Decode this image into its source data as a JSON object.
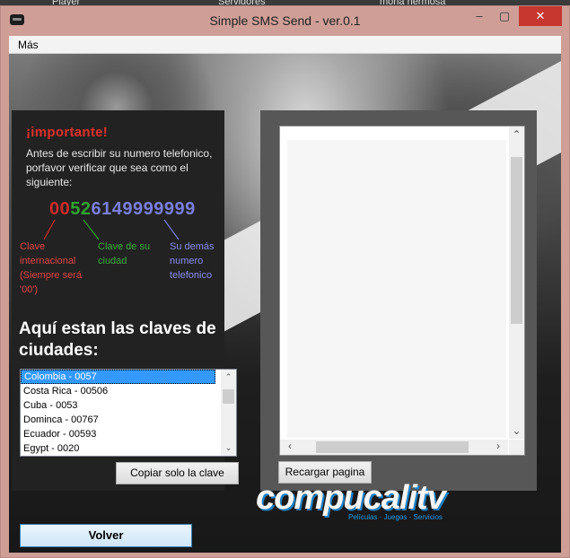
{
  "desktop": {
    "items": [
      "Player",
      "Servidores",
      "mona hermosa"
    ]
  },
  "window": {
    "title": "Simple SMS Send - ver.0.1",
    "controls": {
      "minimize": "–",
      "maximize": "▢",
      "close": "✕"
    }
  },
  "menu": {
    "mas": "Más"
  },
  "left_panel": {
    "important_title": "¡importante!",
    "instructions": "Antes de escribir su numero telefonico, porfavor verificar que sea como el siguiente:",
    "phone_example": {
      "country": "00",
      "city": "52",
      "number": "6149999999"
    },
    "captions": {
      "country": "Clave internacional (Siempre será '00')",
      "city": "Clave de su ciudad",
      "number": "Su demás numero telefonico"
    },
    "cities_title": "Aquí estan las claves de ciudades:",
    "cities": [
      "Colombia - 0057",
      "Costa Rica - 00506",
      "Cuba - 0053",
      "Dominca - 00767",
      "Ecuador - 00593",
      "Egypt - 0020"
    ],
    "selected_index": 0,
    "copy_button": "Copiar solo la clave"
  },
  "right_panel": {
    "reload_button": "Recargar pagina"
  },
  "back_button": "Volver",
  "watermark": {
    "brand": "compucalitv",
    "tagline": "Películas · Juegos · Servicios"
  },
  "colors": {
    "important": "#e0302a",
    "country_code": "#d22a2a",
    "city_code": "#2fa52f",
    "number": "#7a7ee0",
    "close_button": "#c7372f",
    "selection": "#3399ff"
  }
}
